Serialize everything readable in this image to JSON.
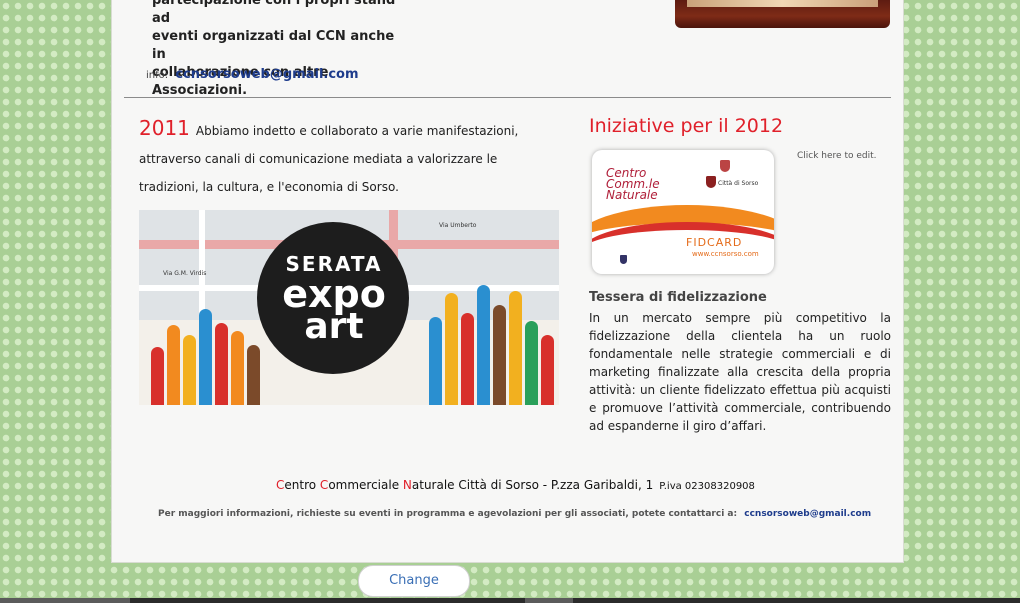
{
  "top": {
    "text_lines": [
      "partecipazione con i propri stand ad",
      "eventi organizzati dal CCN anche in",
      "collaborazione con altre Associazioni."
    ],
    "info_label": "info:",
    "info_email": "ccnsorsoweb@gmail.com"
  },
  "intro": {
    "year": "2011",
    "text": "Abbiamo indetto e collaborato a varie manifestazioni, attraverso canali di comunicazione mediata a valorizzare le tradizioni, la cultura, e l'economia di Sorso."
  },
  "banner": {
    "line1": "SERATA",
    "line2": "expo",
    "line3": "art",
    "map_labels": [
      "Via G.M. Virdis",
      "Via Umberto"
    ]
  },
  "iniziative": {
    "heading": "Iniziative per il  2012",
    "click_to_edit": "Click here to edit."
  },
  "card": {
    "logo_line1": "Centro",
    "logo_line2": "Comm.le",
    "logo_line3": "Naturale",
    "fidcard": "FIDCARD",
    "website": "www.ccnsorso.com",
    "city": "Città di Sorso"
  },
  "tessera": {
    "title": "Tessera di fidelizzazione",
    "body": "In un mercato sempre più competitivo la fidelizzazione della clientela ha un ruolo fondamentale nelle strategie commerciali e di marketing finalizzate alla crescita della propria attività: un cliente fidelizzato effettua più acquisti e promuove l’attività commerciale, contribuendo ad espanderne il giro d’affari."
  },
  "footer": {
    "c1": "C",
    "w1": "entro ",
    "c2": "C",
    "w2": "ommerciale ",
    "c3": "N",
    "w3": "aturale  Città di Sorso  - P.zza Garibaldi, 1",
    "piva": "P.iva 02308320908",
    "info_text": "Per maggiori informazioni, richieste su eventi in programma e agevolazioni per gli associati,  potete contattarci a:",
    "info_email": "ccnsorsoweb@gmail.com"
  },
  "change_button": "Change",
  "colors": {
    "accent_red": "#e0202a",
    "link_blue": "#1e3c8c",
    "background_green": "#a9cf95"
  }
}
